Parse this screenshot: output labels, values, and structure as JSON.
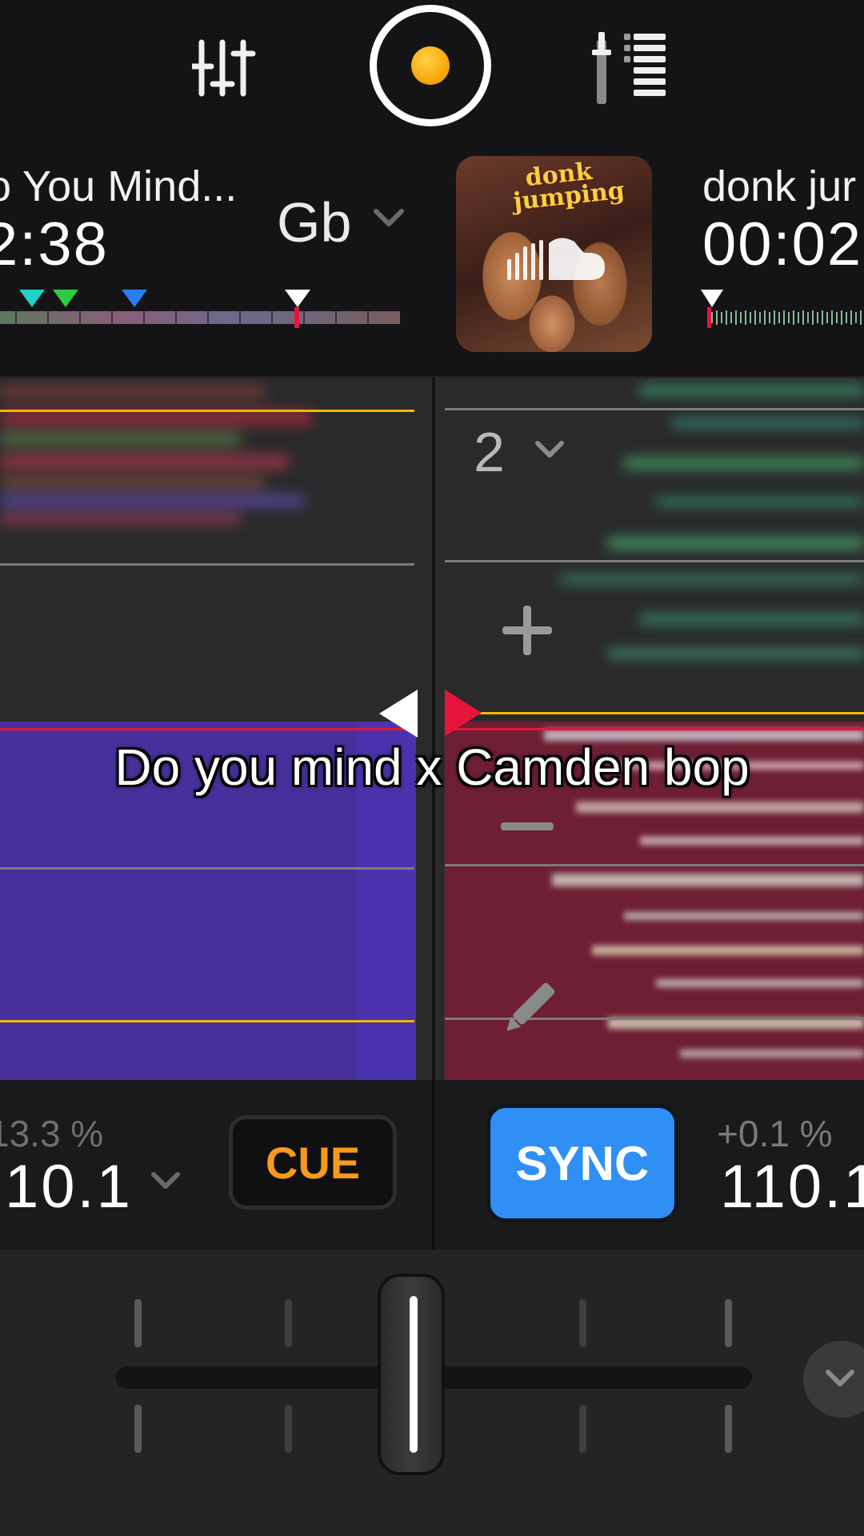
{
  "toolbar": {
    "mixer_icon": "mixer-sliders-icon",
    "record_icon": "record-icon",
    "levels_icon": "level-meter-icon",
    "record_dot_color": "#f5a300"
  },
  "deck_left": {
    "title": "o You Mind...",
    "time": "2:38",
    "key": "Gb",
    "pitch": "13.3 %",
    "bpm": "10.1",
    "cue_label": "CUE",
    "color": "#4a2fa8"
  },
  "deck_right": {
    "title": "donk jur",
    "time": "00:02",
    "pitch": "+0.1 %",
    "bpm": "110.1",
    "sync_label": "SYNC",
    "color": "#7a1f35",
    "artwork": {
      "title": "donk jumping",
      "overlay_icon": "soundcloud-icon"
    }
  },
  "waveform": {
    "zoom_label": "2",
    "zoom_in_icon": "plus-icon",
    "zoom_out_icon": "minus-icon",
    "edit_icon": "pencil-icon"
  },
  "caption": "Do you mind x Camden bop",
  "crossfader": {
    "collapse_icon": "chevron-down-icon"
  },
  "colors": {
    "accent_orange": "#f59a1a",
    "sync_blue": "#2f8ff5",
    "beat_line_yellow": "#f5b700",
    "playhead_red": "#e8143c"
  }
}
